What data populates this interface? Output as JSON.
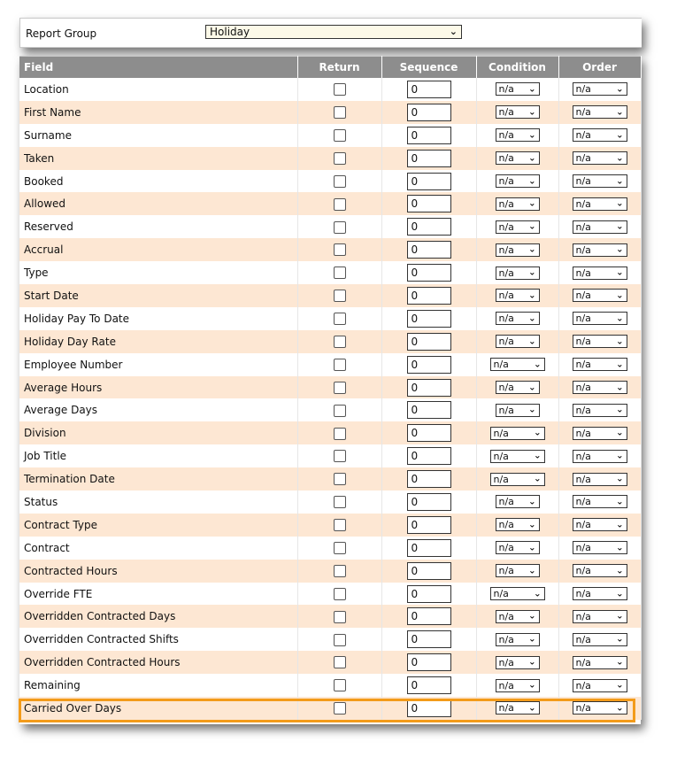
{
  "report_group": {
    "label": "Report Group",
    "value": "Holiday"
  },
  "columns": {
    "field": "Field",
    "return": "Return",
    "sequence": "Sequence",
    "condition": "Condition",
    "order": "Order"
  },
  "rows": [
    {
      "field": "Location",
      "sequence": "0",
      "condition": "n/a",
      "order": "n/a"
    },
    {
      "field": "First Name",
      "sequence": "0",
      "condition": "n/a",
      "order": "n/a"
    },
    {
      "field": "Surname",
      "sequence": "0",
      "condition": "n/a",
      "order": "n/a"
    },
    {
      "field": "Taken",
      "sequence": "0",
      "condition": "n/a",
      "order": "n/a"
    },
    {
      "field": "Booked",
      "sequence": "0",
      "condition": "n/a",
      "order": "n/a"
    },
    {
      "field": "Allowed",
      "sequence": "0",
      "condition": "n/a",
      "order": "n/a"
    },
    {
      "field": "Reserved",
      "sequence": "0",
      "condition": "n/a",
      "order": "n/a"
    },
    {
      "field": "Accrual",
      "sequence": "0",
      "condition": "n/a",
      "order": "n/a"
    },
    {
      "field": "Type",
      "sequence": "0",
      "condition": "n/a",
      "order": "n/a"
    },
    {
      "field": "Start Date",
      "sequence": "0",
      "condition": "n/a",
      "order": "n/a"
    },
    {
      "field": "Holiday Pay To Date",
      "sequence": "0",
      "condition": "n/a",
      "order": "n/a"
    },
    {
      "field": "Holiday Day Rate",
      "sequence": "0",
      "condition": "n/a",
      "order": "n/a"
    },
    {
      "field": "Employee Number",
      "sequence": "0",
      "condition": "n/a",
      "order": "n/a"
    },
    {
      "field": "Average Hours",
      "sequence": "0",
      "condition": "n/a",
      "order": "n/a"
    },
    {
      "field": "Average Days",
      "sequence": "0",
      "condition": "n/a",
      "order": "n/a"
    },
    {
      "field": "Division",
      "sequence": "0",
      "condition": "n/a",
      "order": "n/a"
    },
    {
      "field": "Job Title",
      "sequence": "0",
      "condition": "n/a",
      "order": "n/a"
    },
    {
      "field": "Termination Date",
      "sequence": "0",
      "condition": "n/a",
      "order": "n/a"
    },
    {
      "field": "Status",
      "sequence": "0",
      "condition": "n/a",
      "order": "n/a"
    },
    {
      "field": "Contract Type",
      "sequence": "0",
      "condition": "n/a",
      "order": "n/a"
    },
    {
      "field": "Contract",
      "sequence": "0",
      "condition": "n/a",
      "order": "n/a"
    },
    {
      "field": "Contracted Hours",
      "sequence": "0",
      "condition": "n/a",
      "order": "n/a"
    },
    {
      "field": "Override FTE",
      "sequence": "0",
      "condition": "n/a",
      "order": "n/a"
    },
    {
      "field": "Overridden Contracted Days",
      "sequence": "0",
      "condition": "n/a",
      "order": "n/a"
    },
    {
      "field": "Overridden Contracted Shifts",
      "sequence": "0",
      "condition": "n/a",
      "order": "n/a"
    },
    {
      "field": "Overridden Contracted Hours",
      "sequence": "0",
      "condition": "n/a",
      "order": "n/a"
    },
    {
      "field": "Remaining",
      "sequence": "0",
      "condition": "n/a",
      "order": "n/a"
    },
    {
      "field": "Carried Over Days",
      "sequence": "0",
      "condition": "n/a",
      "order": "n/a",
      "highlighted": true
    }
  ],
  "icons": {
    "dropdown": "chevron-down-icon"
  },
  "colors": {
    "header_bg": "#8d8d8d",
    "alt_row_bg": "#fde7d3",
    "highlight": "#f39b1a"
  }
}
